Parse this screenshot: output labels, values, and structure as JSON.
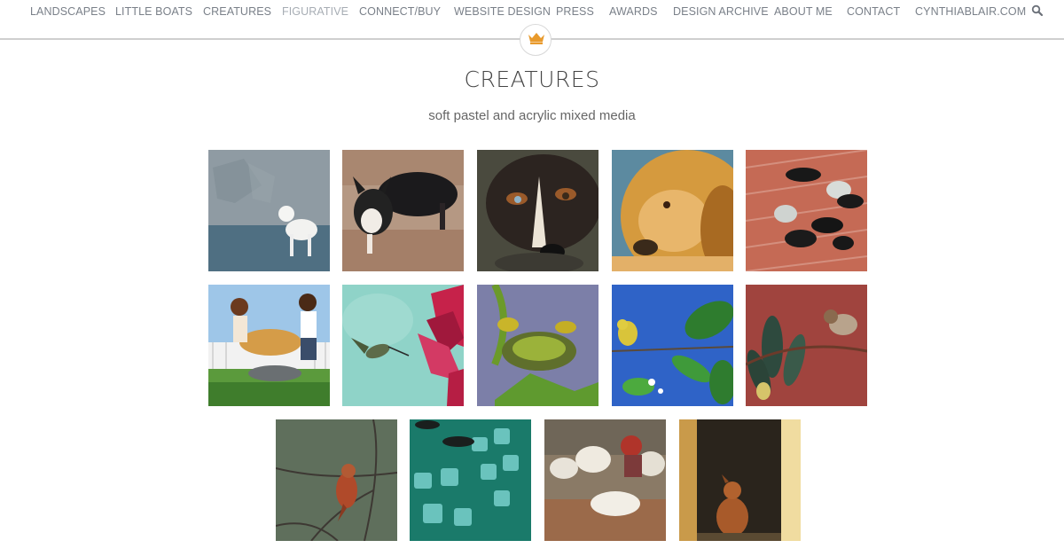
{
  "nav": {
    "items": [
      {
        "label": "LANDSCAPES"
      },
      {
        "label": "LITTLE BOATS"
      },
      {
        "label": "CREATURES"
      },
      {
        "label": "FIGURATIVE"
      },
      {
        "label": "CONNECT/BUY"
      },
      {
        "label": "WEBSITE DESIGN"
      },
      {
        "label": "PRESS"
      },
      {
        "label": "AWARDS"
      },
      {
        "label": "DESIGN ARCHIVE"
      },
      {
        "label": "ABOUT ME"
      },
      {
        "label": "CONTACT"
      },
      {
        "label": "CYNTHIABLAIR.COM"
      }
    ],
    "search_icon": "search-icon"
  },
  "logo_icon": "crown-icon",
  "page": {
    "title": "CREATURES",
    "subtitle": "soft pastel and acrylic mixed media"
  },
  "colors": {
    "accent": "#e89a2c",
    "nav_text": "#7a8089",
    "rule": "#cfcfcf"
  }
}
